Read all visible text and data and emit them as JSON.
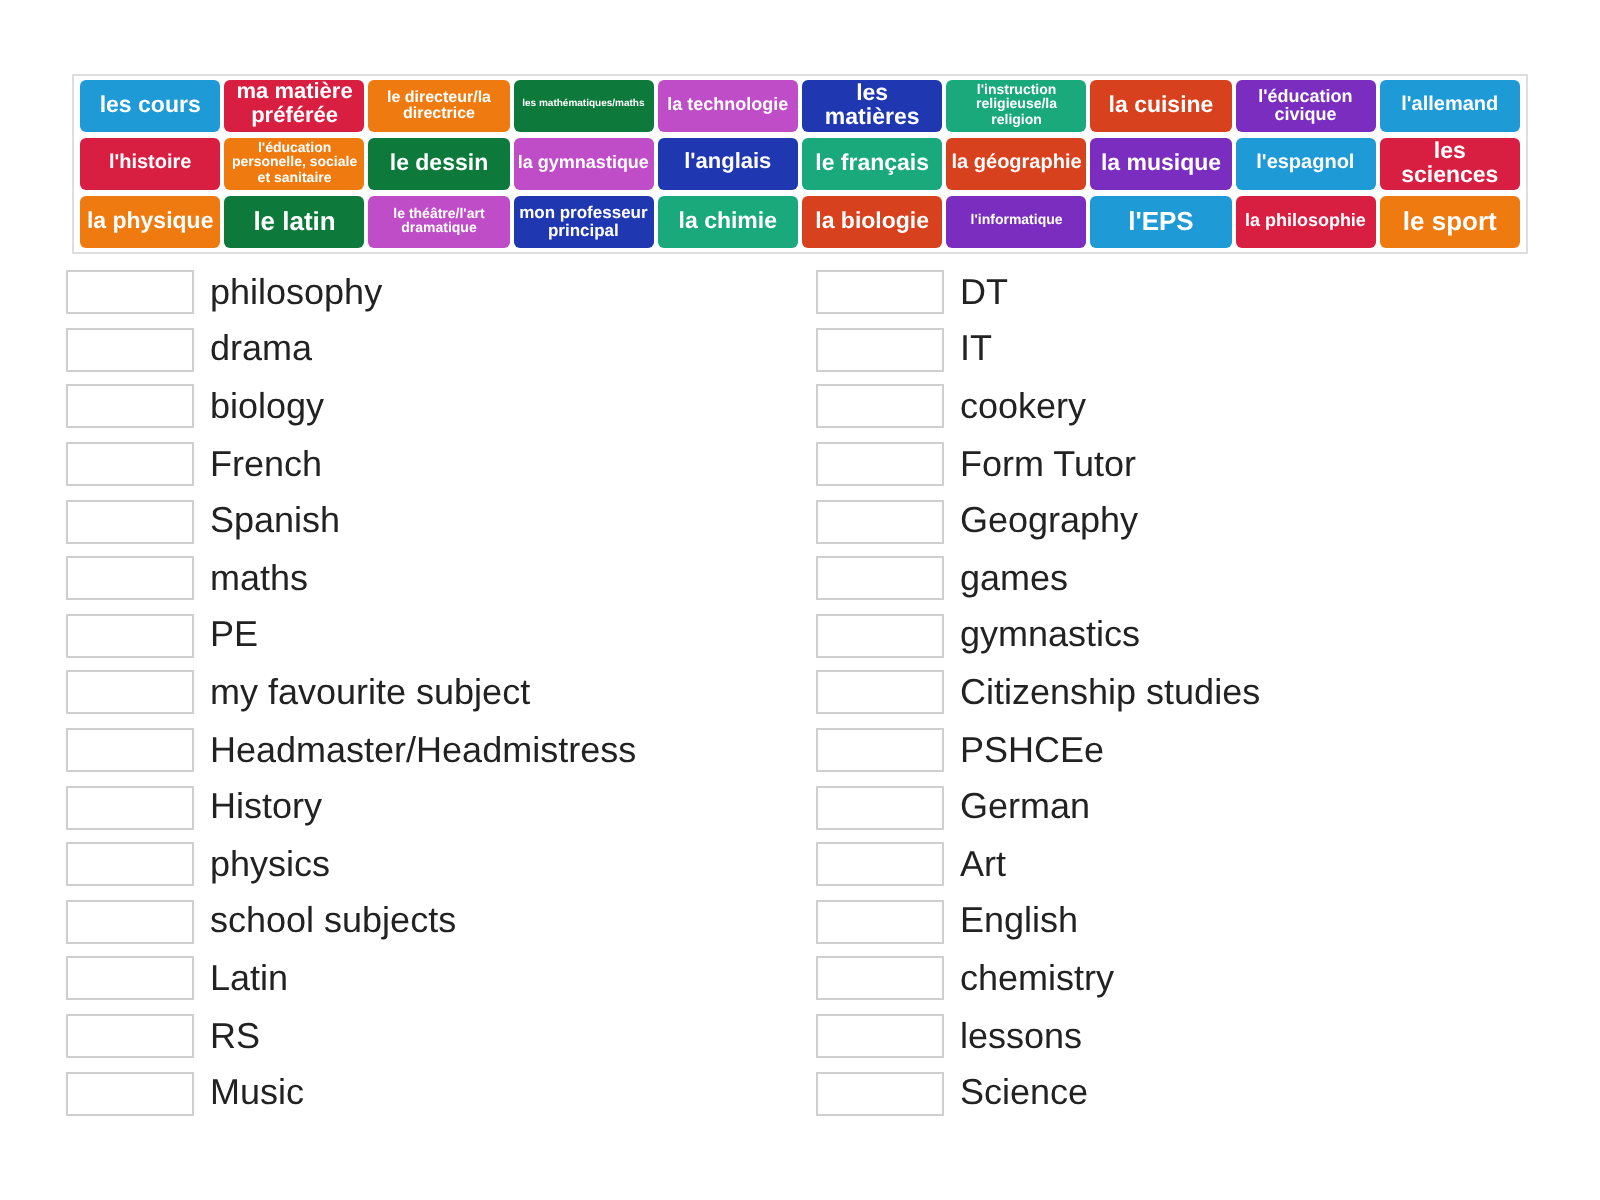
{
  "tiles": [
    {
      "text": "les cours",
      "color": "#1e9ad6"
    },
    {
      "text": "ma matière préférée",
      "color": "#d91f41"
    },
    {
      "text": "le directeur/la directrice",
      "color": "#ef7b10"
    },
    {
      "text": "les mathématiques/maths",
      "color": "#0d7a3c"
    },
    {
      "text": "la technologie",
      "color": "#c04dc8"
    },
    {
      "text": "les matières",
      "color": "#2037b2"
    },
    {
      "text": "l'instruction religieuse/la religion",
      "color": "#1aa97a"
    },
    {
      "text": "la cuisine",
      "color": "#d8411d"
    },
    {
      "text": "l'éducation civique",
      "color": "#7a2dbf"
    },
    {
      "text": "l'allemand",
      "color": "#1e9ad6"
    },
    {
      "text": "l'histoire",
      "color": "#d91f41"
    },
    {
      "text": "l'éducation personelle, sociale et sanitaire",
      "color": "#ef7b10"
    },
    {
      "text": "le dessin",
      "color": "#0d7a3c"
    },
    {
      "text": "la gymnastique",
      "color": "#c04dc8"
    },
    {
      "text": "l'anglais",
      "color": "#2037b2"
    },
    {
      "text": "le français",
      "color": "#1aa97a"
    },
    {
      "text": "la géographie",
      "color": "#d8411d"
    },
    {
      "text": "la musique",
      "color": "#7a2dbf"
    },
    {
      "text": "l'espagnol",
      "color": "#1e9ad6"
    },
    {
      "text": "les sciences",
      "color": "#d91f41"
    },
    {
      "text": "la physique",
      "color": "#ef7b10"
    },
    {
      "text": "le latin",
      "color": "#0d7a3c"
    },
    {
      "text": "le théâtre/l'art dramatique",
      "color": "#c04dc8"
    },
    {
      "text": "mon professeur principal",
      "color": "#2037b2"
    },
    {
      "text": "la chimie",
      "color": "#1aa97a"
    },
    {
      "text": "la biologie",
      "color": "#d8411d"
    },
    {
      "text": "l'informatique",
      "color": "#7a2dbf"
    },
    {
      "text": "l'EPS",
      "color": "#1e9ad6"
    },
    {
      "text": "la philosophie",
      "color": "#d91f41"
    },
    {
      "text": "le sport",
      "color": "#ef7b10"
    }
  ],
  "left_prompts": [
    "philosophy",
    "drama",
    "biology",
    "French",
    "Spanish",
    "maths",
    "PE",
    "my favourite subject",
    "Headmaster/Headmistress",
    "History",
    "physics",
    "school subjects",
    "Latin",
    "RS",
    "Music"
  ],
  "right_prompts": [
    "DT",
    "IT",
    "cookery",
    "Form Tutor",
    "Geography",
    "games",
    "gymnastics",
    "Citizenship studies",
    "PSHCEe",
    "German",
    "Art",
    "English",
    "chemistry",
    "lessons",
    "Science"
  ]
}
